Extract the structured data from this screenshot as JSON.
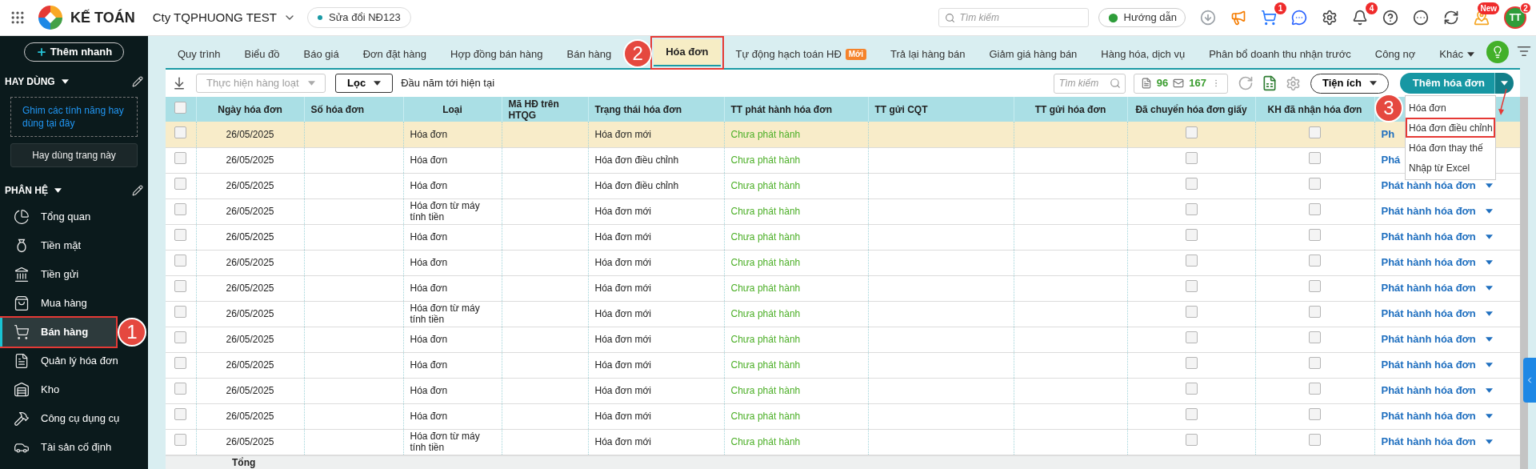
{
  "topbar": {
    "app_name": "KẾ TOÁN",
    "company": "Cty TQPHUONG TEST",
    "version_badge": "Sửa đổi NĐ123",
    "search": {
      "placeholder": "Tìm kiếm"
    },
    "guide_button": "Hướng dẫn",
    "icons": [
      {
        "kind": "download"
      },
      {
        "kind": "megaphone"
      },
      {
        "kind": "cart",
        "badge": "1"
      },
      {
        "kind": "chat"
      },
      {
        "kind": "settings"
      },
      {
        "kind": "bell",
        "badge": "4"
      },
      {
        "kind": "help"
      },
      {
        "kind": "more"
      },
      {
        "kind": "sync"
      },
      {
        "kind": "map",
        "badge": "New"
      }
    ],
    "avatar": {
      "initials": "TT",
      "badge": "2"
    }
  },
  "sidebar": {
    "quick_add": "Thêm nhanh",
    "favorites": {
      "title": "HAY DÙNG",
      "hint": "Ghim các tính năng hay dùng tại đây",
      "button": "Hay dùng trang này"
    },
    "modules": {
      "title": "PHÂN HỆ",
      "items": [
        {
          "kind": "overview",
          "label": "Tổng quan",
          "selected": false
        },
        {
          "kind": "cash",
          "label": "Tiền mặt",
          "selected": false
        },
        {
          "kind": "bank",
          "label": "Tiền gửi",
          "selected": false
        },
        {
          "kind": "purchase",
          "label": "Mua hàng",
          "selected": false
        },
        {
          "kind": "sales",
          "label": "Bán hàng",
          "selected": true,
          "callout": "1"
        },
        {
          "kind": "invoice",
          "label": "Quản lý hóa đơn",
          "selected": false
        },
        {
          "kind": "warehouse",
          "label": "Kho",
          "selected": false
        },
        {
          "kind": "tools",
          "label": "Công cụ dụng cụ",
          "selected": false
        },
        {
          "kind": "assets",
          "label": "Tài sản cố định",
          "selected": false
        }
      ]
    }
  },
  "tabs": [
    {
      "label": "Quy trình",
      "selected": false
    },
    {
      "label": "Biểu đồ",
      "selected": false
    },
    {
      "label": "Báo giá",
      "selected": false
    },
    {
      "label": "Đơn đặt hàng",
      "selected": false
    },
    {
      "label": "Hợp đồng bán hàng",
      "selected": false
    },
    {
      "label": "Bán hàng",
      "selected": false
    },
    {
      "label": "Hóa đơn",
      "selected": true,
      "callout": "2"
    },
    {
      "label": "Tự động hạch toán HĐ",
      "selected": false,
      "badge": "Mới"
    },
    {
      "label": "Trả lại hàng bán",
      "selected": false
    },
    {
      "label": "Giảm giá hàng bán",
      "selected": false
    },
    {
      "label": "Hàng hóa, dịch vụ",
      "selected": false
    },
    {
      "label": "Phân bổ doanh thu nhận trước",
      "selected": false
    },
    {
      "label": "Công nợ",
      "selected": false
    },
    {
      "label": "Khác",
      "selected": false,
      "dropdown": true
    }
  ],
  "toolbar": {
    "bulk_action": {
      "label": "Thực hiện hàng loạt",
      "disabled": true
    },
    "filter": "Lọc",
    "period": "Đầu năm tới hiện tại",
    "search": {
      "placeholder": "Tìm kiếm"
    },
    "count_invoices": "96",
    "count_emails": "167",
    "utilities": "Tiện ích",
    "add_button": "Thêm hóa đơn",
    "add_menu": {
      "expanded": true,
      "items": [
        {
          "label": "Hóa đơn"
        },
        {
          "label": "Hóa đơn điều chỉnh",
          "callout": "3"
        },
        {
          "label": "Hóa đơn thay thế"
        },
        {
          "label": "Nhập từ Excel"
        }
      ]
    }
  },
  "table": {
    "all_checked": false,
    "columns": [
      "Ngày hóa đơn",
      "Số hóa đơn",
      "Loại",
      "Mã HĐ trên HTQG",
      "Trạng thái hóa đơn",
      "TT phát hành hóa đơn",
      "TT gửi CQT",
      "TT gửi hóa đơn",
      "Đã chuyển hóa đơn giấy",
      "KH đã nhận hóa đơn"
    ],
    "rows": [
      {
        "selected": true,
        "checked": false,
        "date": "26/05/2025",
        "type": "Hóa đơn",
        "status": "Hóa đơn mới",
        "issue_status": "Chưa phát hành",
        "paper_transferred": false,
        "customer_received": false,
        "action": {
          "text": "Ph",
          "caret": false
        }
      },
      {
        "selected": false,
        "checked": false,
        "date": "26/05/2025",
        "type": "Hóa đơn",
        "status": "Hóa đơn điều chỉnh",
        "issue_status": "Chưa phát hành",
        "paper_transferred": false,
        "customer_received": false,
        "action": {
          "text": "Phá",
          "caret": false
        }
      },
      {
        "selected": false,
        "checked": false,
        "date": "26/05/2025",
        "type": "Hóa đơn",
        "status": "Hóa đơn điều chỉnh",
        "issue_status": "Chưa phát hành",
        "paper_transferred": false,
        "customer_received": false,
        "action": {
          "text": "Phát hành hóa đơn",
          "caret": true
        }
      },
      {
        "selected": false,
        "checked": false,
        "date": "26/05/2025",
        "type": "Hóa đơn từ máy tính tiền",
        "status": "Hóa đơn mới",
        "issue_status": "Chưa phát hành",
        "paper_transferred": false,
        "customer_received": false,
        "action": {
          "text": "Phát hành hóa đơn",
          "caret": true
        }
      },
      {
        "selected": false,
        "checked": false,
        "date": "26/05/2025",
        "type": "Hóa đơn",
        "status": "Hóa đơn mới",
        "issue_status": "Chưa phát hành",
        "paper_transferred": false,
        "customer_received": false,
        "action": {
          "text": "Phát hành hóa đơn",
          "caret": true
        }
      },
      {
        "selected": false,
        "checked": false,
        "date": "26/05/2025",
        "type": "Hóa đơn",
        "status": "Hóa đơn mới",
        "issue_status": "Chưa phát hành",
        "paper_transferred": false,
        "customer_received": false,
        "action": {
          "text": "Phát hành hóa đơn",
          "caret": true
        }
      },
      {
        "selected": false,
        "checked": false,
        "date": "26/05/2025",
        "type": "Hóa đơn",
        "status": "Hóa đơn mới",
        "issue_status": "Chưa phát hành",
        "paper_transferred": false,
        "customer_received": false,
        "action": {
          "text": "Phát hành hóa đơn",
          "caret": true
        }
      },
      {
        "selected": false,
        "checked": false,
        "date": "26/05/2025",
        "type": "Hóa đơn từ máy tính tiền",
        "status": "Hóa đơn mới",
        "issue_status": "Chưa phát hành",
        "paper_transferred": false,
        "customer_received": false,
        "action": {
          "text": "Phát hành hóa đơn",
          "caret": true
        }
      },
      {
        "selected": false,
        "checked": false,
        "date": "26/05/2025",
        "type": "Hóa đơn",
        "status": "Hóa đơn mới",
        "issue_status": "Chưa phát hành",
        "paper_transferred": false,
        "customer_received": false,
        "action": {
          "text": "Phát hành hóa đơn",
          "caret": true
        }
      },
      {
        "selected": false,
        "checked": false,
        "date": "26/05/2025",
        "type": "Hóa đơn",
        "status": "Hóa đơn mới",
        "issue_status": "Chưa phát hành",
        "paper_transferred": false,
        "customer_received": false,
        "action": {
          "text": "Phát hành hóa đơn",
          "caret": true
        }
      },
      {
        "selected": false,
        "checked": false,
        "date": "26/05/2025",
        "type": "Hóa đơn",
        "status": "Hóa đơn mới",
        "issue_status": "Chưa phát hành",
        "paper_transferred": false,
        "customer_received": false,
        "action": {
          "text": "Phát hành hóa đơn",
          "caret": true
        }
      },
      {
        "selected": false,
        "checked": false,
        "date": "26/05/2025",
        "type": "Hóa đơn",
        "status": "Hóa đơn mới",
        "issue_status": "Chưa phát hành",
        "paper_transferred": false,
        "customer_received": false,
        "action": {
          "text": "Phát hành hóa đơn",
          "caret": true
        }
      },
      {
        "selected": false,
        "checked": false,
        "date": "26/05/2025",
        "type": "Hóa đơn từ máy tính tiền",
        "status": "Hóa đơn mới",
        "issue_status": "Chưa phát hành",
        "paper_transferred": false,
        "customer_received": false,
        "action": {
          "text": "Phát hành hóa đơn",
          "caret": true
        }
      }
    ],
    "footer": "Tổng"
  }
}
